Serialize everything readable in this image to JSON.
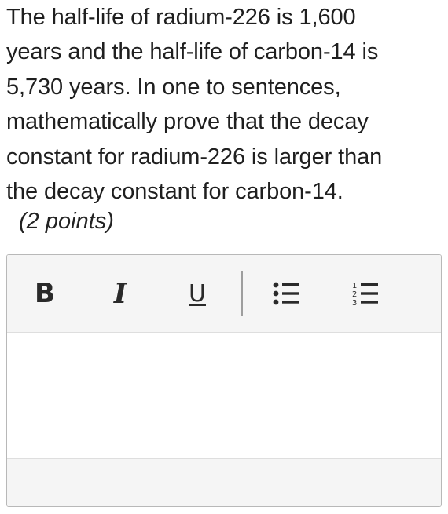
{
  "question": {
    "lines": [
      "The half-life of radium-226 is 1,600",
      "years and the half-life of carbon-14 is",
      "5,730 years. In one to sentences,",
      "mathematically prove that the decay",
      "constant for radium-226 is larger than",
      "the decay constant for carbon-14."
    ],
    "points": "(2 points)"
  },
  "editor": {
    "toolbar": {
      "bold_label": "B",
      "italic_label": "I",
      "underline_label": "U",
      "bullets_icon": "bulleted-list-icon",
      "numbers_icon": "numbered-list-icon"
    },
    "content": ""
  },
  "colors": {
    "text": "#1f1f1f",
    "toolbar_bg": "#f5f5f5",
    "border": "#b8b8b8",
    "icon": "#2a2a2a"
  }
}
